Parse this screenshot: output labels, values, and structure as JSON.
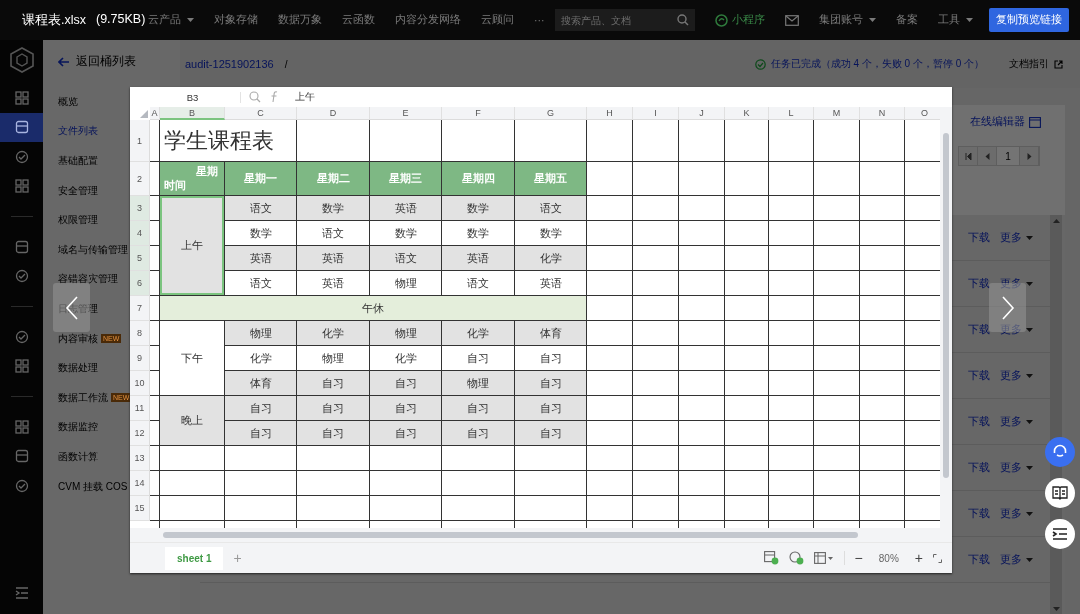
{
  "viewer": {
    "file_name": "课程表.xlsx",
    "file_size": "(9.75KB)",
    "copy_button": "复制预览链接"
  },
  "top_nav": {
    "items": [
      {
        "label": "云产品",
        "dropdown": true
      },
      {
        "label": "对象存储",
        "dropdown": false
      },
      {
        "label": "数据万象",
        "dropdown": false
      },
      {
        "label": "云函数",
        "dropdown": false
      },
      {
        "label": "内容分发网络",
        "dropdown": false
      },
      {
        "label": "云顾问",
        "dropdown": false
      }
    ],
    "more": "···",
    "search": {
      "placeholder": "搜索产品、文档"
    },
    "right_items": [
      {
        "kind": "app",
        "label": "小程序"
      },
      {
        "kind": "mail"
      },
      {
        "kind": "menu",
        "label": "集团账号",
        "dropdown": true
      },
      {
        "kind": "menu",
        "label": "备案",
        "dropdown": false
      },
      {
        "kind": "menu",
        "label": "工具",
        "dropdown": true
      }
    ]
  },
  "rail_groups": [
    {
      "items": [
        {
          "selected": false
        },
        {
          "selected": true
        },
        {
          "selected": false
        },
        {
          "selected": false
        }
      ]
    },
    {
      "items": [
        {
          "selected": false
        },
        {
          "selected": false
        }
      ]
    },
    {
      "items": [
        {
          "selected": false
        },
        {
          "selected": false
        }
      ]
    },
    {
      "items": [
        {
          "selected": false
        },
        {
          "selected": false
        },
        {
          "selected": false
        }
      ]
    }
  ],
  "sidebar": {
    "back": "返回桶列表",
    "items": [
      {
        "label": "概览",
        "selected": false
      },
      {
        "label": "文件列表",
        "selected": true
      },
      {
        "label": "基础配置",
        "selected": false
      },
      {
        "label": "安全管理",
        "selected": false
      },
      {
        "label": "权限管理",
        "selected": false
      },
      {
        "label": "域名与传输管理",
        "selected": false
      },
      {
        "label": "容错容灾管理",
        "selected": false
      },
      {
        "label": "日志管理",
        "selected": false
      },
      {
        "label": "内容审核",
        "selected": false,
        "badge": "NEW"
      },
      {
        "label": "数据处理",
        "selected": false
      },
      {
        "label": "数据工作流",
        "selected": false,
        "badge": "NEW"
      },
      {
        "label": "数据监控",
        "selected": false
      },
      {
        "label": "函数计算",
        "selected": false
      },
      {
        "label": "CVM 挂载 COS",
        "selected": false
      }
    ]
  },
  "breadcrumb": {
    "bucket": "audit-1251902136",
    "separator": "/"
  },
  "task_status": "任务已完成（成功 4 个，失败 0 个，暂停 0 个）",
  "docs_link": "文档指引",
  "toolbar": {
    "editor_link": "在线编辑器",
    "page": "1"
  },
  "file_rows": [
    {
      "download": "下载",
      "more": "更多"
    },
    {
      "download": "下载",
      "more": "更多"
    },
    {
      "download": "下载",
      "more": "更多"
    },
    {
      "download": "下载",
      "more": "更多"
    },
    {
      "download": "下载",
      "more": "更多"
    },
    {
      "download": "下载",
      "more": "更多"
    },
    {
      "download": "下载",
      "more": "更多"
    },
    {
      "download": "下载",
      "more": "更多"
    }
  ],
  "sheet": {
    "name_box": "B3",
    "formula": "上午",
    "columns": [
      {
        "label": "A",
        "selected": false
      },
      {
        "label": "B",
        "selected": true
      },
      {
        "label": "C",
        "selected": false
      },
      {
        "label": "D",
        "selected": false
      },
      {
        "label": "E",
        "selected": false
      },
      {
        "label": "F",
        "selected": false
      },
      {
        "label": "G",
        "selected": false
      },
      {
        "label": "H",
        "selected": false
      },
      {
        "label": "I",
        "selected": false
      },
      {
        "label": "J",
        "selected": false
      },
      {
        "label": "K",
        "selected": false
      },
      {
        "label": "L",
        "selected": false
      },
      {
        "label": "M",
        "selected": false
      },
      {
        "label": "N",
        "selected": false
      },
      {
        "label": "O",
        "selected": false
      }
    ],
    "rows": [
      {
        "label": "1",
        "selected": false
      },
      {
        "label": "2",
        "selected": false
      },
      {
        "label": "3",
        "selected": true
      },
      {
        "label": "4",
        "selected": true
      },
      {
        "label": "5",
        "selected": true
      },
      {
        "label": "6",
        "selected": true
      },
      {
        "label": "7",
        "selected": false
      },
      {
        "label": "8",
        "selected": false
      },
      {
        "label": "9",
        "selected": false
      },
      {
        "label": "10",
        "selected": false
      },
      {
        "label": "11",
        "selected": false
      },
      {
        "label": "12",
        "selected": false
      },
      {
        "label": "13",
        "selected": false
      },
      {
        "label": "14",
        "selected": false
      },
      {
        "label": "15",
        "selected": false
      }
    ],
    "title": "学生课程表",
    "corner": {
      "top": "星期",
      "bottom": "时间"
    },
    "days": [
      "星期一",
      "星期二",
      "星期三",
      "星期四",
      "星期五"
    ],
    "blocks": [
      {
        "kind": "period",
        "label": "上午",
        "shaded": true,
        "selected": true,
        "lessons": [
          {
            "cells": [
              "语文",
              "数学",
              "英语",
              "数学",
              "语文"
            ],
            "shaded": true
          },
          {
            "cells": [
              "数学",
              "语文",
              "数学",
              "数学",
              "数学"
            ],
            "shaded": false
          },
          {
            "cells": [
              "英语",
              "英语",
              "语文",
              "英语",
              "化学"
            ],
            "shaded": true
          },
          {
            "cells": [
              "语文",
              "英语",
              "物理",
              "语文",
              "英语"
            ],
            "shaded": false
          }
        ]
      },
      {
        "kind": "break",
        "label": "午休"
      },
      {
        "kind": "period",
        "label": "下午",
        "shaded": false,
        "selected": false,
        "lessons": [
          {
            "cells": [
              "物理",
              "化学",
              "物理",
              "化学",
              "体育"
            ],
            "shaded": true
          },
          {
            "cells": [
              "化学",
              "物理",
              "化学",
              "自习",
              "自习"
            ],
            "shaded": false
          },
          {
            "cells": [
              "体育",
              "自习",
              "自习",
              "物理",
              "自习"
            ],
            "shaded": true
          }
        ]
      },
      {
        "kind": "period",
        "label": "晚上",
        "shaded": true,
        "selected": false,
        "lessons": [
          {
            "cells": [
              "自习",
              "自习",
              "自习",
              "自习",
              "自习"
            ],
            "shaded": true
          },
          {
            "cells": [
              "自习",
              "自习",
              "自习",
              "自习",
              "自习"
            ],
            "shaded": true
          }
        ]
      }
    ],
    "tabs": [
      {
        "label": "sheet 1",
        "selected": true
      }
    ],
    "add_tab": "+",
    "zoom": {
      "out": "−",
      "level": "80%",
      "in": "+"
    }
  }
}
